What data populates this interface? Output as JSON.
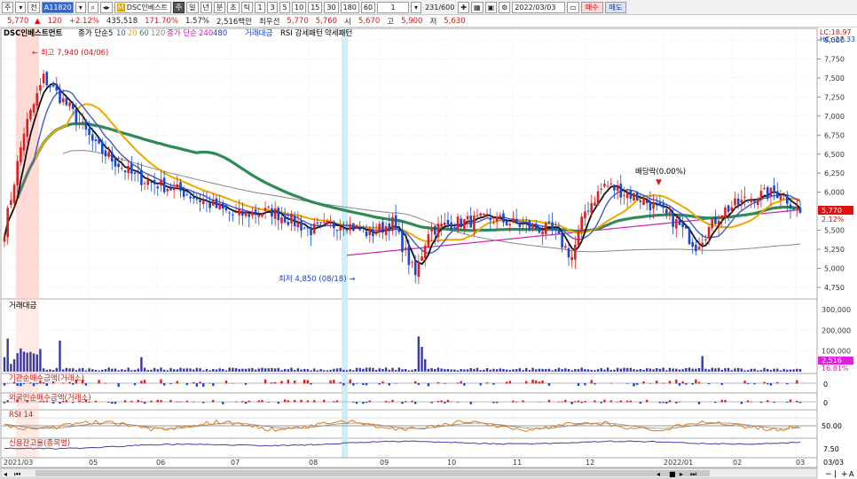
{
  "toolbar": {
    "mode_label": "주",
    "market_label": "전",
    "stock_code": "A11820",
    "stock_name": "DSC인베스트",
    "m_badge": "M",
    "period_buttons": [
      "주",
      "일",
      "년",
      "분",
      "초",
      "틱"
    ],
    "interval_buttons": [
      "1",
      "3",
      "5",
      "10",
      "15",
      "30",
      "180",
      "60"
    ],
    "count_value": "1",
    "page_counter": "231/600",
    "date_value": "2022/03/03",
    "buy_label": "매수",
    "sell_label": "매도"
  },
  "info": {
    "price": "5,770",
    "change": "120",
    "change_pct": "+2.12%",
    "volume": "435,518",
    "vol_ratio": "171.70%",
    "turnover": "1.57%",
    "amount": "2,516백만",
    "preferred": "최우선",
    "ask": "5,770",
    "bid": "5,760",
    "open_label": "시",
    "open": "5,670",
    "high_label": "고",
    "high": "5,900",
    "low_label": "저",
    "low": "5,630"
  },
  "legend": {
    "main": {
      "stock": "DSC인베스트먼트",
      "ma_label": "종가 단순",
      "ma_periods": [
        "5",
        "10",
        "20",
        "60",
        "120"
      ],
      "ma_colors": [
        "#111111",
        "#3d5cc8",
        "#f0a800",
        "#2e8b57",
        "#888888"
      ],
      "ma2_label": "종가 단순",
      "ma2_periods": [
        "240",
        "480"
      ],
      "ma2_colors": [
        "#d020b0",
        "#2040d0"
      ],
      "vol_label": "거래대금",
      "rsi_label": "RSI 강세패턴",
      "weak_label": "약세패턴"
    },
    "volume": "거래대금",
    "inst": "기관순매수금액(거래소)",
    "foreign": "외국인순매수금액(거래소)",
    "rsi": "RSI 14",
    "credit": "신용잔고율(종목별)"
  },
  "annotations": {
    "high_text": "최고 7,940 (04/06)",
    "low_text": "최저 4,850 (08/18)",
    "dividend_text": "배당락(0.00%)"
  },
  "axes": {
    "price_ticks": [
      "8,000",
      "7,750",
      "7,500",
      "7,250",
      "7,000",
      "6,750",
      "6,500",
      "6,250",
      "6,000",
      "5,750",
      "5,500",
      "5,250",
      "5,000",
      "4,750"
    ],
    "lc_text": "LC:18.97",
    "hc_text": "HC:-27.33",
    "price_badge": "5,770",
    "pct_badge": "2.12%",
    "volume_ticks": [
      "300,000",
      "200,000",
      "100,000"
    ],
    "volume_badge": "2,516",
    "volume_pct": "16.81%",
    "inst_tick": "0",
    "foreign_tick": "0",
    "rsi_tick": "50.00",
    "credit_tick": "7.50",
    "x_labels": [
      "2021/03",
      "05",
      "06",
      "07",
      "08",
      "09",
      "10",
      "11",
      "12",
      "2022/01",
      "02",
      "03"
    ],
    "x_right": "03/03"
  },
  "colors": {
    "up": "#e02020",
    "down": "#1848d0",
    "ma5": "#111111",
    "ma10": "#3d5cc8",
    "ma20": "#f0a800",
    "ma60": "#2e8b57",
    "ma120": "#888888",
    "ma240": "#d020b0",
    "rsi": "#e07818",
    "credit": "#5038b0"
  },
  "nav": {
    "icons": [
      "zoom-out-icon",
      "zoom-in-icon",
      "plus-icon",
      "font-icon"
    ]
  }
}
